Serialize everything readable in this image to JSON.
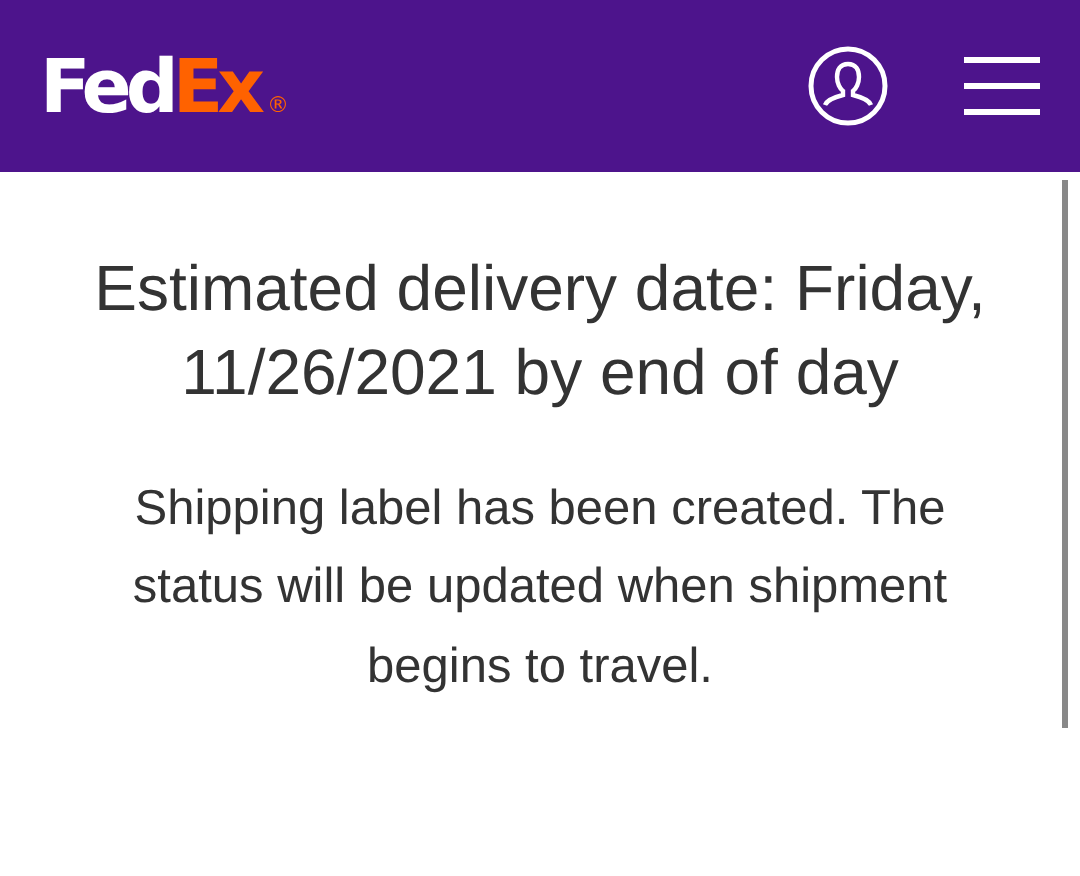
{
  "header": {
    "logo": {
      "first": "Fed",
      "second": "Ex",
      "mark": "®"
    }
  },
  "delivery": {
    "heading": "Estimated delivery date: Friday, 11/26/2021 by end of day",
    "message": "Shipping label has been created. The status will be updated when shipment begins to travel."
  }
}
